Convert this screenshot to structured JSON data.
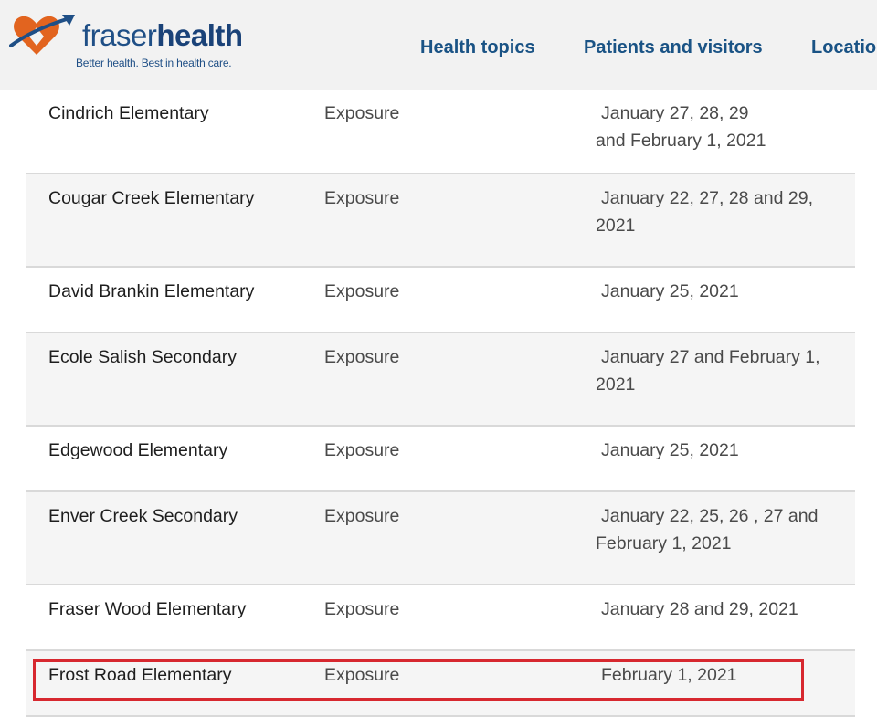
{
  "header": {
    "brand_light": "fraser",
    "brand_bold": "health",
    "tagline": "Better health. Best in health care.",
    "logo_icon": "heart-with-arrow-icon",
    "nav": [
      {
        "label": "Health topics"
      },
      {
        "label": "Patients and visitors"
      },
      {
        "label": "Locatio"
      }
    ]
  },
  "colors": {
    "header_bg": "#f2f2f2",
    "brand_blue": "#1f4f86",
    "logo_orange": "#e2641f",
    "nav_text": "#1a5385",
    "row_alt_bg": "#f5f5f5",
    "row_border": "#d9d9d9",
    "highlight": "#d7282f"
  },
  "rows": [
    {
      "school": "Cindrich Elementary",
      "type": "Exposure",
      "date_line1": "January 27, 28, 29",
      "date_line2": "and February 1,  2021"
    },
    {
      "school": "Cougar Creek Elementary",
      "type": "Exposure",
      "date_line1": "January 22, 27, 28 and 29,",
      "date_line2": "2021"
    },
    {
      "school": "David Brankin Elementary",
      "type": "Exposure",
      "date_line1": "January 25, 2021",
      "date_line2": ""
    },
    {
      "school": "Ecole Salish Secondary",
      "type": "Exposure",
      "date_line1": "January 27 and February 1,",
      "date_line2": "2021"
    },
    {
      "school": "Edgewood Elementary",
      "type": "Exposure",
      "date_line1": "January 25, 2021",
      "date_line2": ""
    },
    {
      "school": "Enver Creek Secondary",
      "type": "Exposure",
      "date_line1": "January 22, 25, 26 , 27 and",
      "date_line2": "February 1, 2021"
    },
    {
      "school": "Fraser Wood Elementary",
      "type": "Exposure",
      "date_line1": "January 28 and 29, 2021",
      "date_line2": ""
    },
    {
      "school": "Frost Road Elementary",
      "type": "Exposure",
      "date_line1": "February 1, 2021",
      "date_line2": ""
    }
  ]
}
